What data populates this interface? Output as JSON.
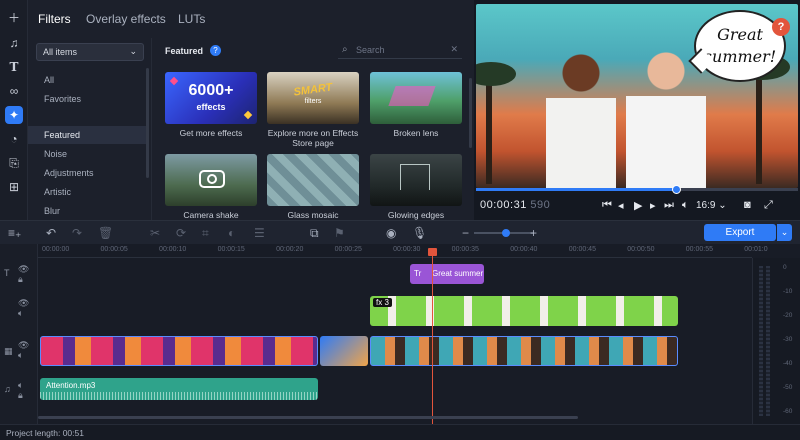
{
  "tabs": [
    "Filters",
    "Overlay effects",
    "LUTs"
  ],
  "categories": {
    "dropdown": "All items",
    "items": [
      "All",
      "Favorites",
      "Featured",
      "Noise",
      "Adjustments",
      "Artistic",
      "Blur"
    ]
  },
  "effects": {
    "section_title": "Featured",
    "search_placeholder": "Search",
    "cards": [
      {
        "label": "Get more effects",
        "thumb_text": "6000+",
        "thumb_sub": "effects"
      },
      {
        "label": "Explore more on Effects Store page",
        "thumb_text": "SMART",
        "thumb_sub": "filters"
      },
      {
        "label": "Broken lens"
      },
      {
        "label": "Camera shake"
      },
      {
        "label": "Glass mosaic"
      },
      {
        "label": "Glowing edges"
      }
    ]
  },
  "preview": {
    "bubble_text": "Great summer!",
    "help_badge": "?",
    "timecode": "00:00:31",
    "timecode_frames": "590",
    "aspect": "16:9",
    "progress": 0.62
  },
  "toolbar": {
    "export_label": "Export"
  },
  "timeline": {
    "ruler": [
      "00:00:00",
      "00:00:05",
      "00:00:10",
      "00:00:15",
      "00:00:20",
      "00:00:25",
      "00:00:30",
      "00:00:35",
      "00:00:40",
      "00:00:45",
      "00:00:50",
      "00:00:55",
      "00:01:0"
    ],
    "title_clip": "Great summer",
    "fx_badge": "fx 3",
    "audio_clip": "Attention.mp3",
    "meter_levels": [
      "0",
      "-10",
      "-20",
      "-30",
      "-40",
      "-50",
      "-60"
    ]
  },
  "status": {
    "project_length": "Project length: 00:51"
  },
  "colors": {
    "accent": "#2f7bf6",
    "playhead": "#e2553c",
    "title_clip": "#9a55d6",
    "overlay_clip": "#7fd34a",
    "audio_clip": "#2fa38b"
  }
}
